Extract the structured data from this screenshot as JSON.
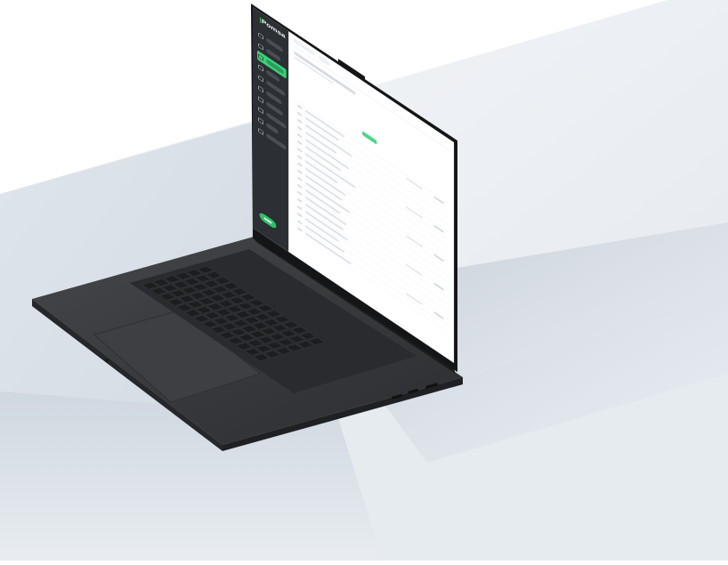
{
  "scene": {
    "description_visible": "",
    "colors": {
      "background_light": "#eef1f4",
      "background_mid": "#d9dfe6",
      "background_shadow": "#c2cbd5",
      "laptop_body": "#343538",
      "laptop_body_edge": "#5a5c60",
      "keyboard_key": "#1e1f21",
      "screen_bezel": "#1a1b1d",
      "sidebar_dark": "#2c2f33",
      "accent_green": "#3ccf7a"
    }
  },
  "app": {
    "brand": "Pomsa",
    "sidebar": {
      "items": [
        {
          "label": "",
          "icon": "dashboard-icon"
        },
        {
          "label": "",
          "icon": "inbox-icon"
        },
        {
          "label": "",
          "icon": "document-icon",
          "active": true
        },
        {
          "label": "",
          "icon": "clients-icon"
        },
        {
          "label": "",
          "icon": "calendar-icon"
        },
        {
          "label": "",
          "icon": "receipt-icon"
        },
        {
          "label": "",
          "icon": "chart-icon"
        },
        {
          "label": "",
          "icon": "bank-icon"
        },
        {
          "label": "",
          "icon": "settings-icon"
        },
        {
          "label": "",
          "icon": "help-icon"
        }
      ]
    }
  }
}
